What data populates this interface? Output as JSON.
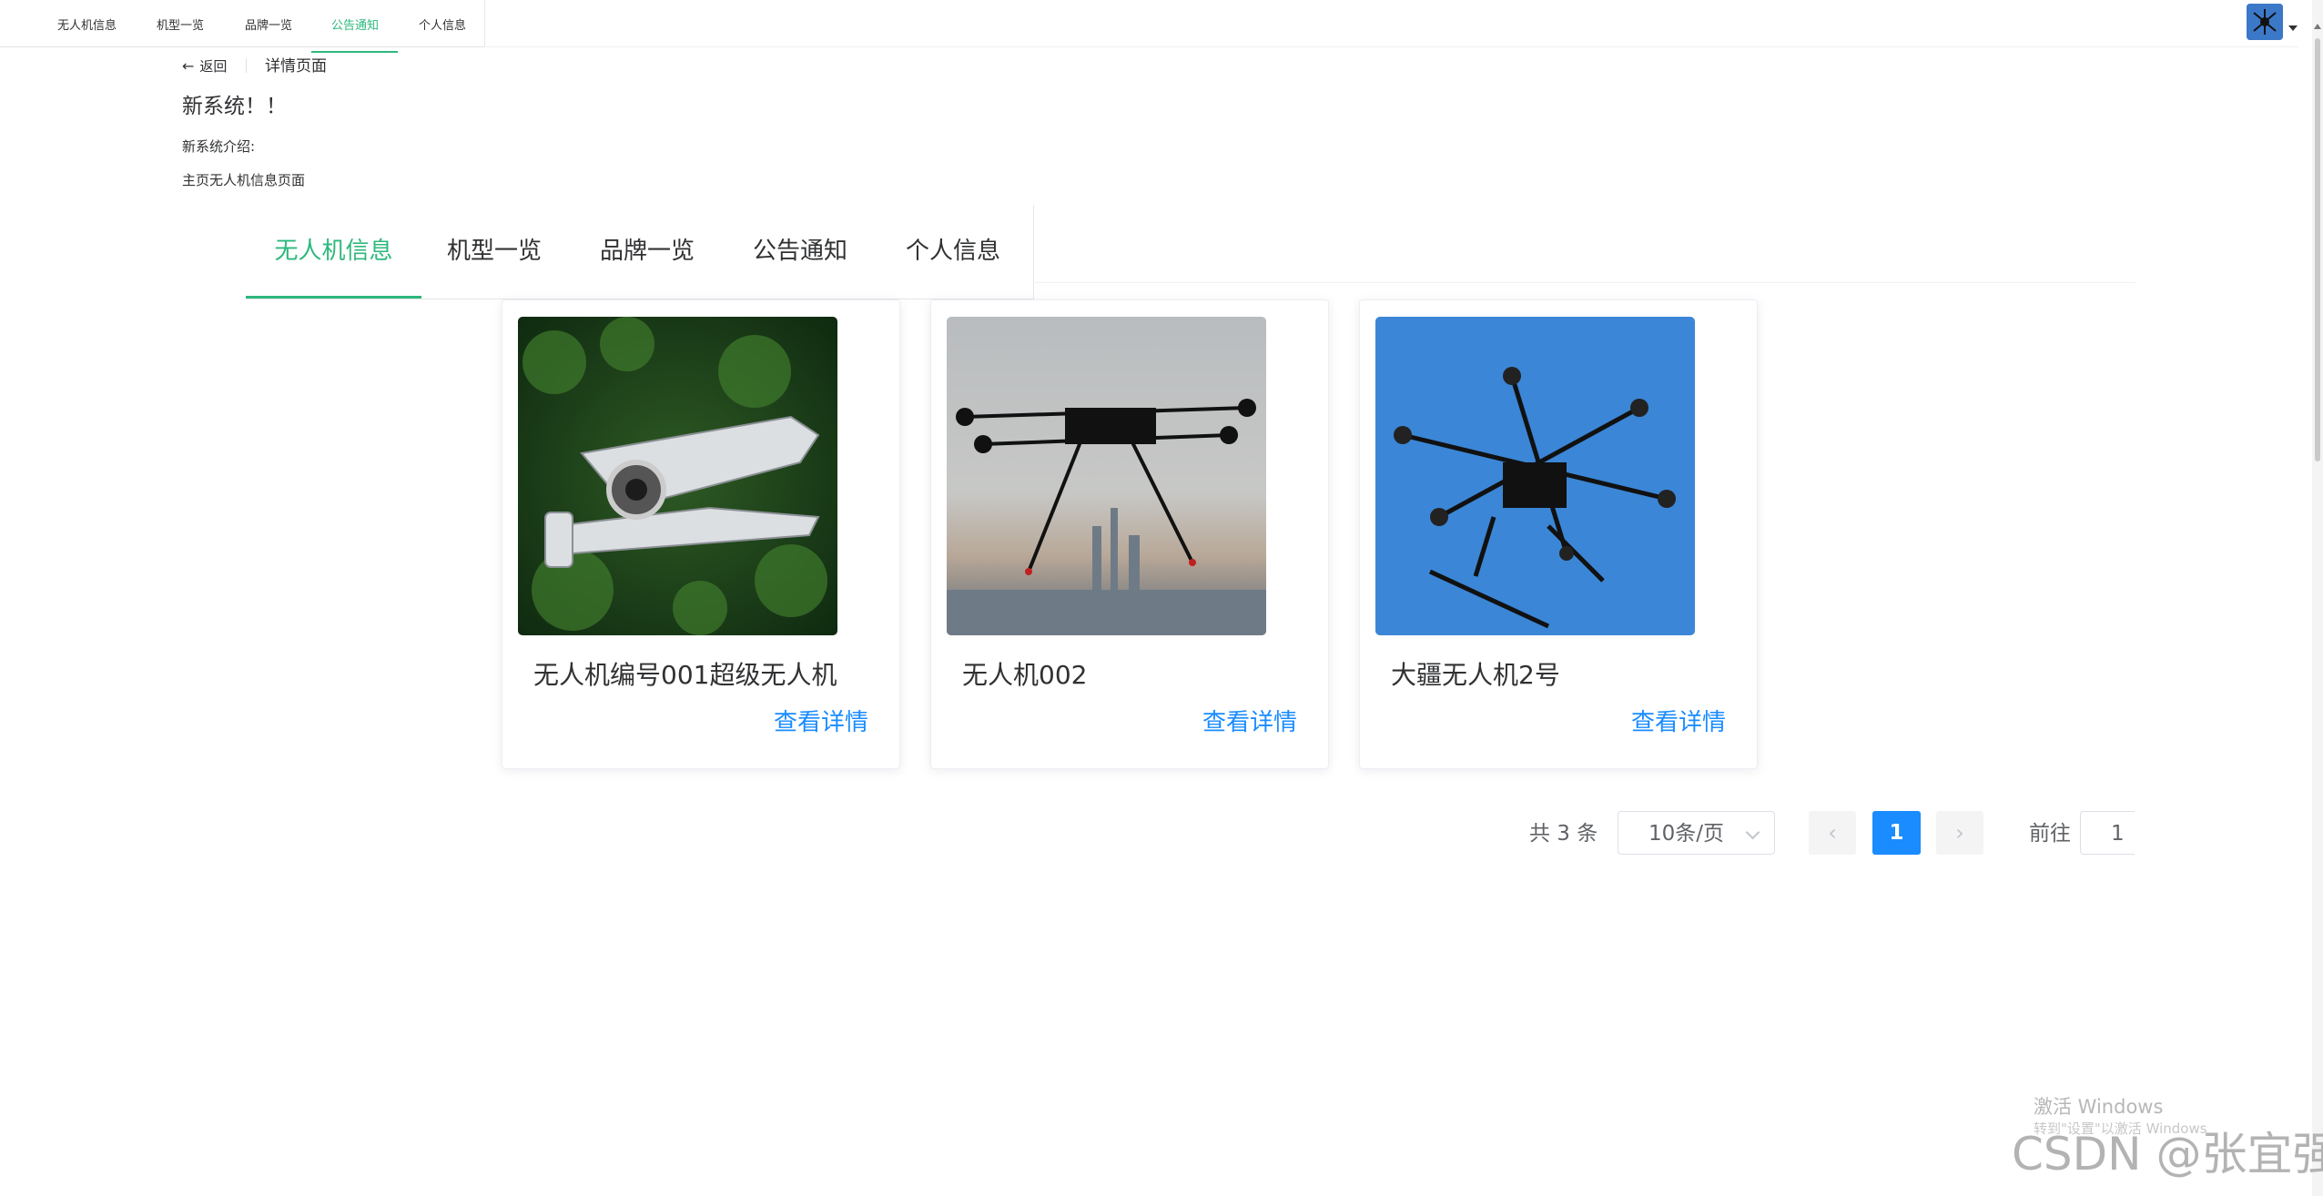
{
  "top_nav": {
    "items": [
      {
        "label": "无人机信息"
      },
      {
        "label": "机型一览"
      },
      {
        "label": "品牌一览"
      },
      {
        "label": "公告通知",
        "active": true
      },
      {
        "label": "个人信息"
      }
    ]
  },
  "page_header": {
    "back_label": "返回",
    "content": "详情页面"
  },
  "notice": {
    "title": "新系统！！",
    "intro": "新系统介绍:",
    "body": "主页无人机信息页面"
  },
  "tabs": {
    "items": [
      {
        "label": "无人机信息",
        "active": true
      },
      {
        "label": "机型一览"
      },
      {
        "label": "品牌一览"
      },
      {
        "label": "公告通知"
      },
      {
        "label": "个人信息"
      }
    ]
  },
  "cards": [
    {
      "name": "无人机编号001超级无人机",
      "link": "查看详情",
      "image_icon": "white-quadcopter-drone-photo"
    },
    {
      "name": "无人机002",
      "link": "查看详情",
      "image_icon": "black-hexacopter-drone-photo"
    },
    {
      "name": "大疆无人机2号",
      "link": "查看详情",
      "image_icon": "black-octocopter-drone-photo"
    }
  ],
  "pagination": {
    "total": "共 3 条",
    "page_size": "10条/页",
    "current_page": "1",
    "prev_icon": "chevron-left-icon",
    "next_icon": "chevron-right-icon",
    "goto_label": "前往",
    "goto_value": "1"
  },
  "watermarks": {
    "activate_title": "激活 Windows",
    "activate_sub": "转到\"设置\"以激活 Windows",
    "csdn": "CSDN @张宜强"
  },
  "colors": {
    "accent_green": "#2db87d",
    "link_blue": "#1a8cff",
    "text": "#303133",
    "border": "#e6e6e6"
  }
}
